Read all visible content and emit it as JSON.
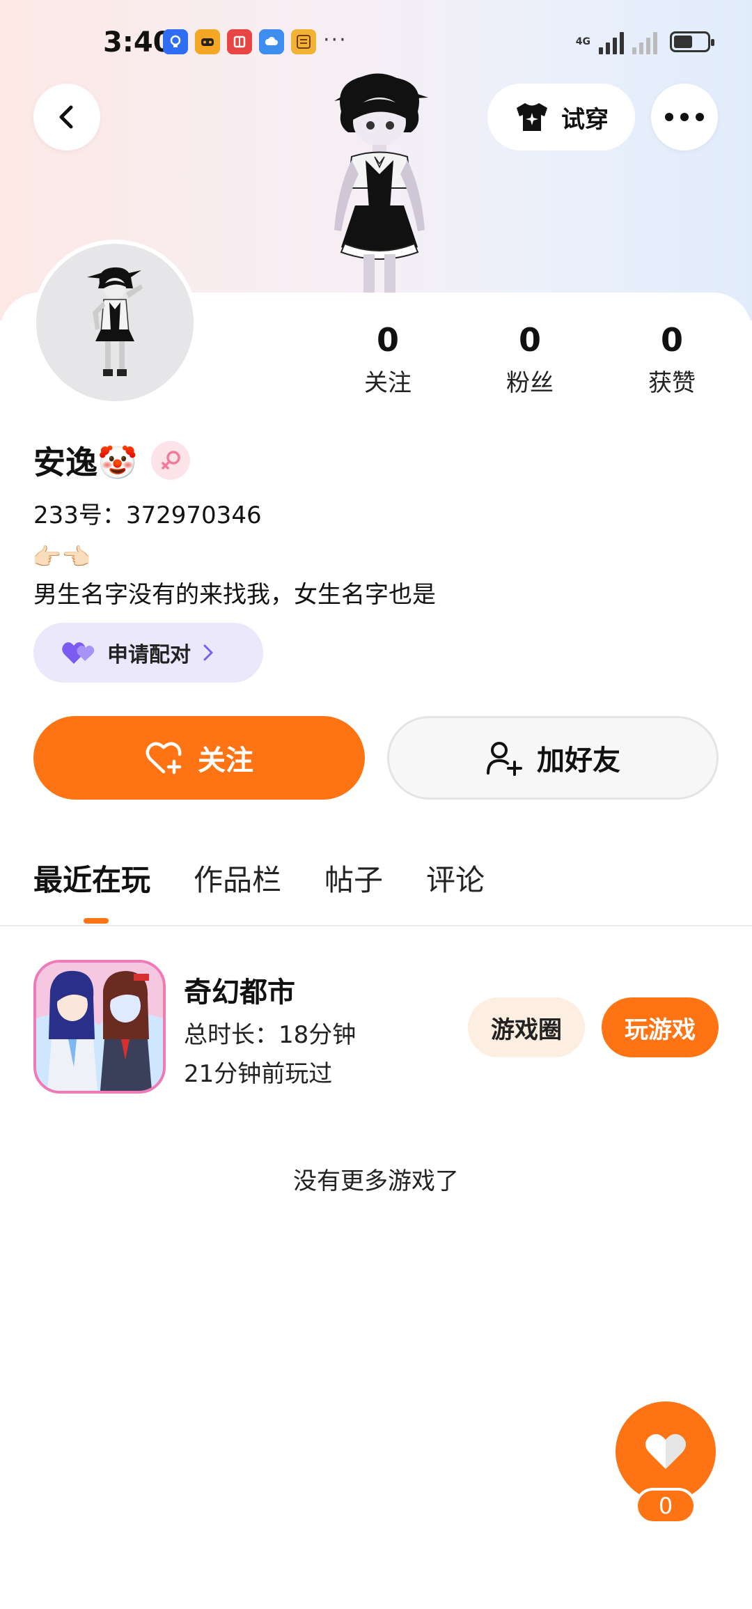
{
  "status_bar": {
    "time": "3:40",
    "more_indicator": "···",
    "network": "4G",
    "notification_icons": [
      "bulb-app-icon",
      "game-app-icon",
      "book-app-icon",
      "cloud-app-icon",
      "dewu-app-icon"
    ]
  },
  "header": {
    "tryon_label": "试穿"
  },
  "profile": {
    "stats": [
      {
        "value": "0",
        "label": "关注"
      },
      {
        "value": "0",
        "label": "粉丝"
      },
      {
        "value": "0",
        "label": "获赞"
      }
    ],
    "name": "安逸🤡",
    "id_line": "233号：372970346",
    "bio_emoji": "👉🏻👈🏻",
    "bio": "男生名字没有的来找我，女生名字也是",
    "pair_label": "申请配对"
  },
  "actions": {
    "follow_label": "关注",
    "add_friend_label": "加好友"
  },
  "tabs": [
    {
      "label": "最近在玩",
      "active": true
    },
    {
      "label": "作品栏",
      "active": false
    },
    {
      "label": "帖子",
      "active": false
    },
    {
      "label": "评论",
      "active": false
    }
  ],
  "games": [
    {
      "title": "奇幻都市",
      "total_time": "总时长：18分钟",
      "last_played": "21分钟前玩过",
      "circle_label": "游戏圈",
      "play_label": "玩游戏"
    }
  ],
  "no_more_text": "没有更多游戏了",
  "like_fab": {
    "count": "0"
  },
  "colors": {
    "accent": "#fe7414",
    "pair_bg": "#ebe8fb",
    "circle_btn_bg": "#fdeee2"
  }
}
